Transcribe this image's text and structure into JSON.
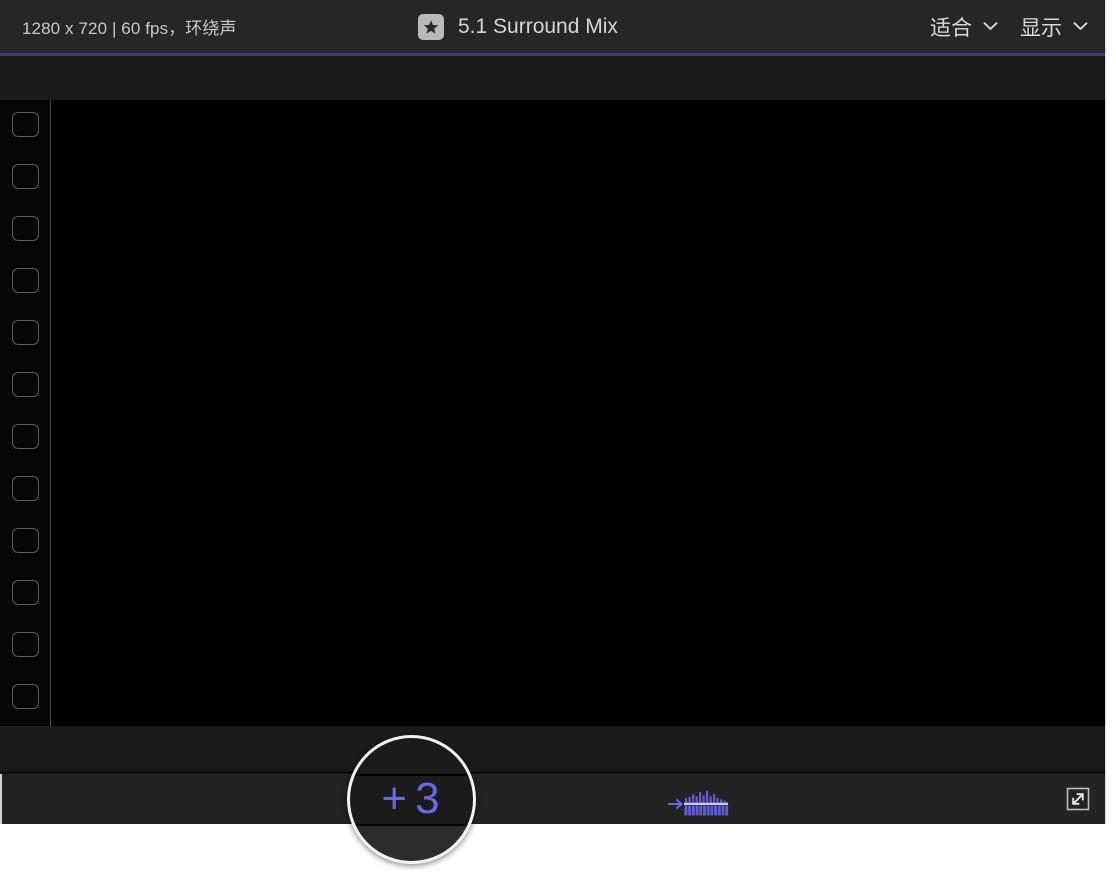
{
  "titlebar": {
    "media_info": "1280 x 720 | 60 fps，环绕声",
    "badge_icon": "star-icon",
    "project_title": "5.1 Surround Mix",
    "fit_button": {
      "label": "适合",
      "icon": "chevron-down-icon"
    },
    "display_button": {
      "label": "显示",
      "icon": "chevron-down-icon"
    }
  },
  "accent_color": "#3b3a77",
  "viewer": {
    "filmstrip": {
      "perforation_count": 12,
      "icon": "film-perforation-icon"
    },
    "canvas": {
      "background": "#000000"
    }
  },
  "toolbar": {
    "audio_meter": {
      "icon": "audio-meter-icon"
    },
    "expand_button": {
      "icon": "expand-diagonal-icon"
    }
  },
  "loupe": {
    "plus": "+",
    "count": "3",
    "accent_color": "#6a66e4"
  }
}
